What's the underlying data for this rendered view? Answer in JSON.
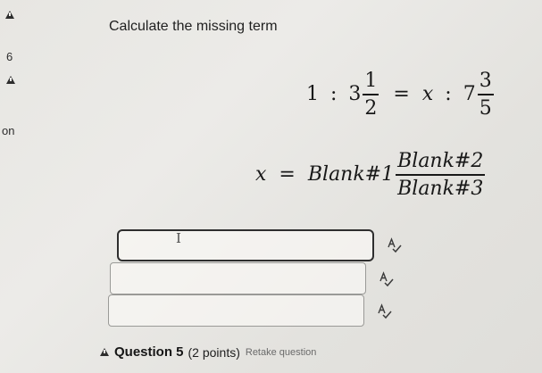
{
  "sidebar": {
    "number": "6",
    "partial_label": "on"
  },
  "question": {
    "title": "Calculate the missing term",
    "label": "Question 5",
    "points": "(2 points)",
    "retake": "Retake question"
  },
  "equation_line1": {
    "lhs_a": "1",
    "colon_1": ":",
    "lhs_whole": "3",
    "lhs_num": "1",
    "lhs_den": "2",
    "equals": "=",
    "var": "x",
    "colon_2": ":",
    "rhs_whole": "7",
    "rhs_num": "3",
    "rhs_den": "5"
  },
  "equation_line2": {
    "var": "x",
    "equals": "=",
    "blank1": "Blank#1",
    "blank2": "Blank#2",
    "blank3": "Blank#3"
  },
  "answers": {
    "blank1_value": "",
    "blank2_value": "",
    "blank3_value": ""
  },
  "cursor_glyph": "I",
  "icons": {
    "alert": "warning-triangle-icon",
    "spellcheck": "spellcheck-icon",
    "text_cursor": "text-cursor-icon"
  },
  "colors": {
    "background": "#e7e6e2",
    "text": "#1b1b1b",
    "input_border": "#9a9a97",
    "focused_border": "#2e2e2e"
  }
}
